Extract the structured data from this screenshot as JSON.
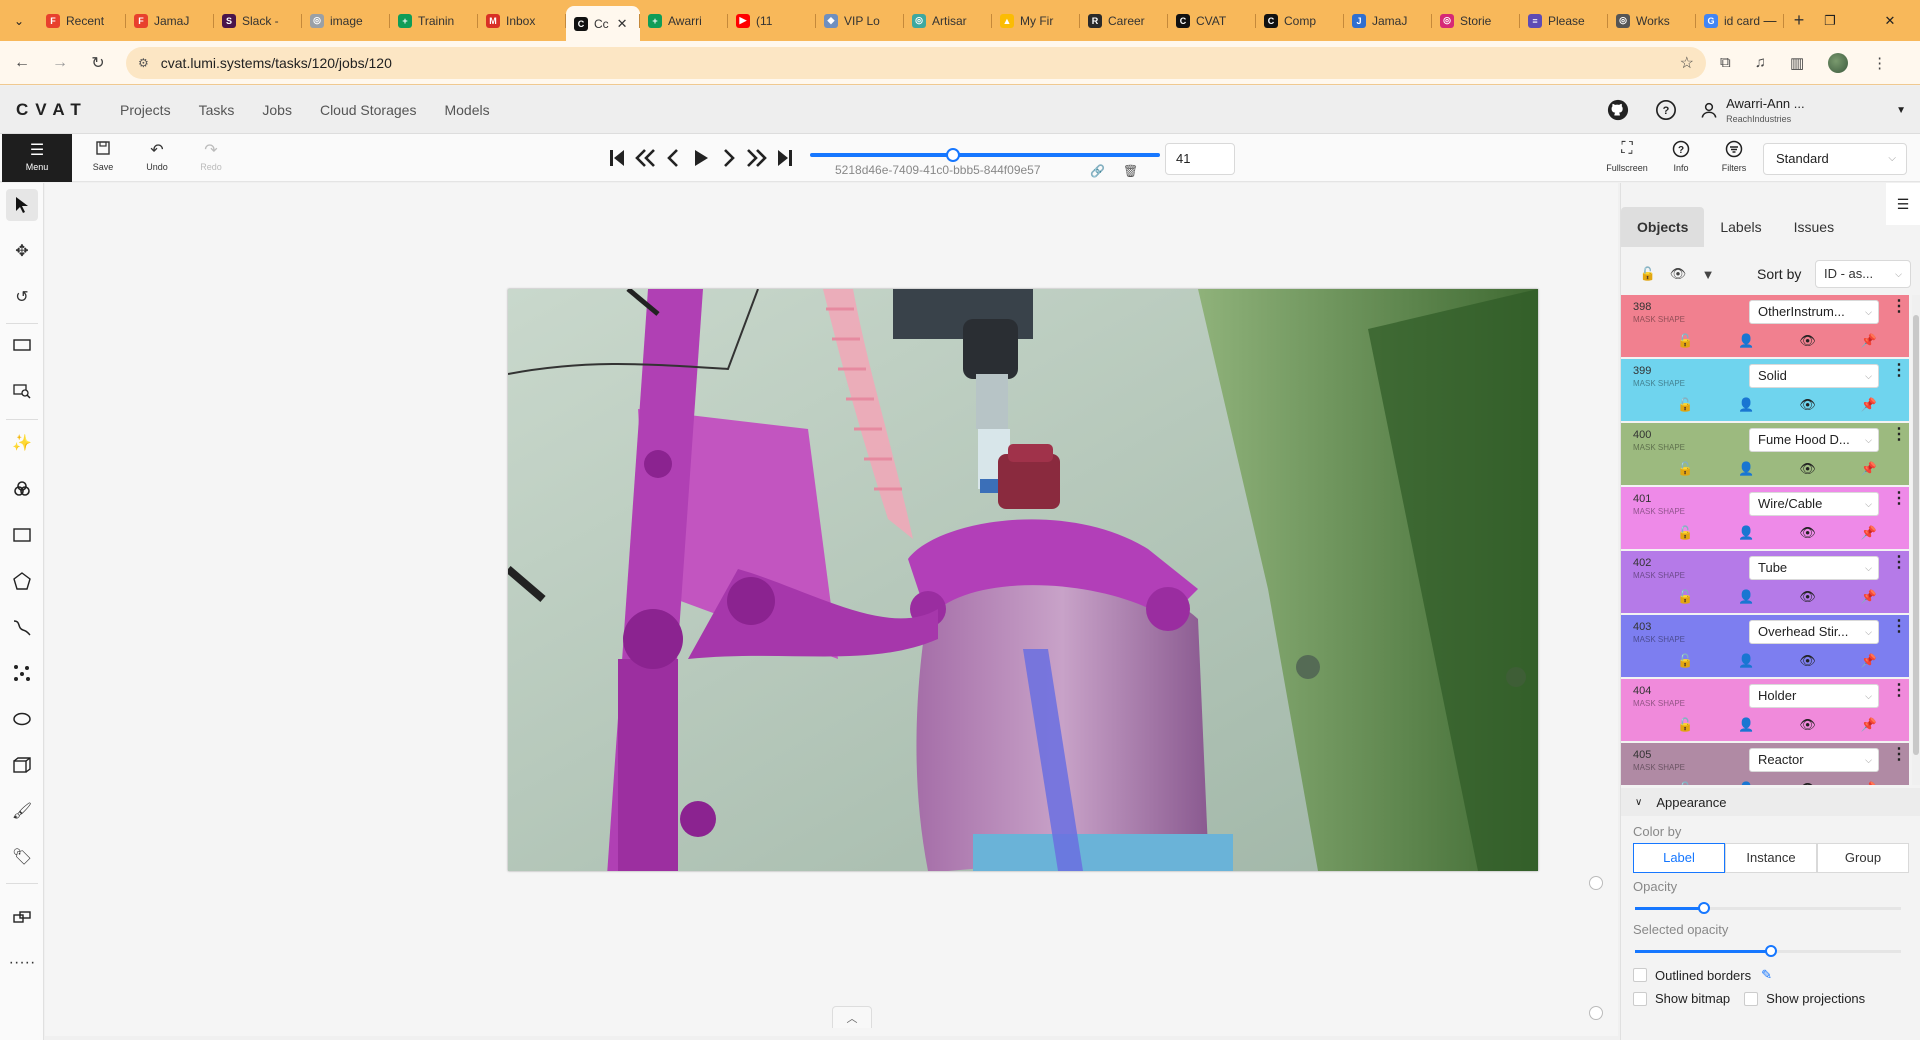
{
  "browser": {
    "tabs": [
      {
        "label": "Recent",
        "color": "#e8402d",
        "glyph": "F"
      },
      {
        "label": "JamaJ",
        "color": "#e8402d",
        "glyph": "F"
      },
      {
        "label": "Slack -",
        "color": "#4a154b",
        "glyph": "S"
      },
      {
        "label": "image",
        "color": "#9aa0a6",
        "glyph": "◎"
      },
      {
        "label": "Trainin",
        "color": "#0f9d58",
        "glyph": "+"
      },
      {
        "label": "Inbox",
        "color": "#d93025",
        "glyph": "M"
      },
      {
        "label": "Cc",
        "color": "#111111",
        "glyph": "C",
        "active": true
      },
      {
        "label": "Awarri",
        "color": "#0f9d58",
        "glyph": "+"
      },
      {
        "label": "(11",
        "color": "#ff0000",
        "glyph": "▶"
      },
      {
        "label": "VIP Lo",
        "color": "#6f8fbf",
        "glyph": "◆"
      },
      {
        "label": "Artisar",
        "color": "#3ea8a0",
        "glyph": "◎"
      },
      {
        "label": "My Fir",
        "color": "#fbbc04",
        "glyph": "▲"
      },
      {
        "label": "Career",
        "color": "#2a2a2a",
        "glyph": "R"
      },
      {
        "label": "CVAT",
        "color": "#111111",
        "glyph": "C"
      },
      {
        "label": "Comp",
        "color": "#111111",
        "glyph": "C"
      },
      {
        "label": "JamaJ",
        "color": "#2f6fd0",
        "glyph": "J"
      },
      {
        "label": "Storie",
        "color": "#d62976",
        "glyph": "◎"
      },
      {
        "label": "Please",
        "color": "#5e4bb5",
        "glyph": "≡"
      },
      {
        "label": "Works",
        "color": "#555555",
        "glyph": "◎"
      },
      {
        "label": "id card",
        "color": "#4285f4",
        "glyph": "G"
      }
    ],
    "new_tab": "+",
    "url": "cvat.lumi.systems/tasks/120/jobs/120"
  },
  "header": {
    "logo": "CVAT",
    "nav": [
      "Projects",
      "Tasks",
      "Jobs",
      "Cloud Storages",
      "Models"
    ],
    "user_name": "Awarri-Ann ...",
    "user_org": "ReachIndustries"
  },
  "toolbar": {
    "menu_label": "Menu",
    "save_label": "Save",
    "undo_label": "Undo",
    "redo_label": "Redo",
    "job_id": "5218d46e-7409-41c0-bbb5-844f09e57",
    "frame_number": "41",
    "fullscreen_label": "Fullscreen",
    "info_label": "Info",
    "filters_label": "Filters",
    "mode": "Standard"
  },
  "sidebar": {
    "tabs": [
      "Objects",
      "Labels",
      "Issues"
    ],
    "sort_label": "Sort by",
    "sort_value": "ID - as...",
    "objects": [
      {
        "id": "398",
        "type": "MASK SHAPE",
        "label": "OtherInstrum...",
        "color": "#f1808f"
      },
      {
        "id": "399",
        "type": "MASK SHAPE",
        "label": "Solid",
        "color": "#6fd4ee"
      },
      {
        "id": "400",
        "type": "MASK SHAPE",
        "label": "Fume Hood D...",
        "color": "#9cba7f"
      },
      {
        "id": "401",
        "type": "MASK SHAPE",
        "label": "Wire/Cable",
        "color": "#ee8ae8"
      },
      {
        "id": "402",
        "type": "MASK SHAPE",
        "label": "Tube",
        "color": "#b57ae8"
      },
      {
        "id": "403",
        "type": "MASK SHAPE",
        "label": "Overhead Stir...",
        "color": "#7d7ef0"
      },
      {
        "id": "404",
        "type": "MASK SHAPE",
        "label": "Holder",
        "color": "#f08adb"
      },
      {
        "id": "405",
        "type": "MASK SHAPE",
        "label": "Reactor",
        "color": "#b08aa4"
      }
    ],
    "appearance": {
      "title": "Appearance",
      "color_by_label": "Color by",
      "color_by_options": [
        "Label",
        "Instance",
        "Group"
      ],
      "color_by_selected": "Label",
      "opacity_label": "Opacity",
      "opacity": 0.26,
      "selected_opacity_label": "Selected opacity",
      "selected_opacity": 0.51,
      "outlined_borders": "Outlined borders",
      "show_bitmap": "Show bitmap",
      "show_projections": "Show projections"
    }
  }
}
